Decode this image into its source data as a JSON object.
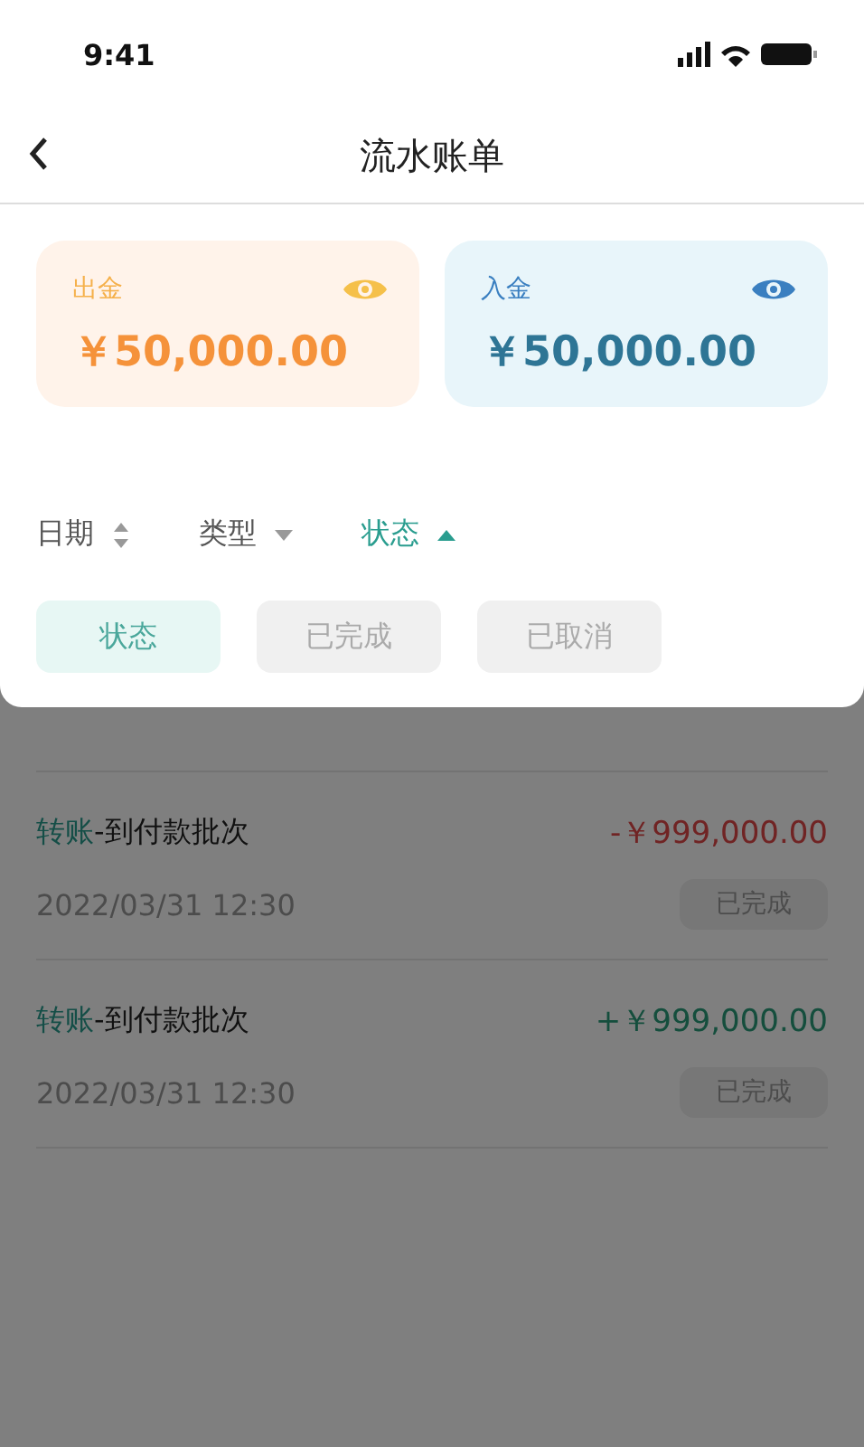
{
  "status_bar": {
    "time": "9:41"
  },
  "nav": {
    "title": "流水账单"
  },
  "balances": [
    {
      "kind": "out",
      "label": "出金",
      "amount": "￥50,000.00"
    },
    {
      "kind": "in",
      "label": "入金",
      "amount": "￥50,000.00"
    }
  ],
  "sorts": [
    {
      "label": "日期",
      "kind": "both",
      "selected": false
    },
    {
      "label": "类型",
      "kind": "down",
      "selected": false
    },
    {
      "label": "状态",
      "kind": "up",
      "selected": true
    }
  ],
  "status_chips": [
    {
      "label": "状态",
      "selected": true
    },
    {
      "label": "已完成",
      "selected": false
    },
    {
      "label": "已取消",
      "selected": false
    }
  ],
  "transactions": [
    {
      "category": "转账",
      "title": "-到付款批次",
      "time": "2022/03/31 12:30",
      "kind": "out",
      "amount": "-￥999,000.00",
      "status": "已完成"
    },
    {
      "category": "转账",
      "title": "-到付款批次",
      "time": "2022/03/31 12:30",
      "kind": "in",
      "amount": "+￥999,000.00",
      "status": "已完成"
    }
  ]
}
